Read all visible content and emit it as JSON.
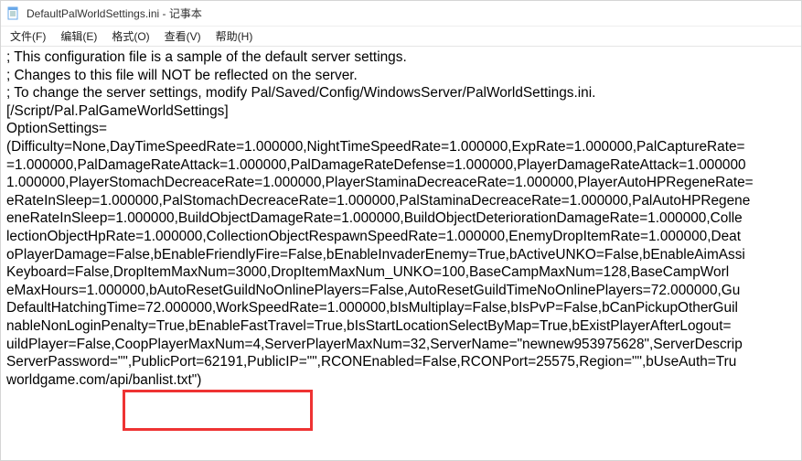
{
  "titlebar": {
    "icon_name": "notepad-icon",
    "title": "DefaultPalWorldSettings.ini - 记事本"
  },
  "menubar": {
    "file": "文件(F)",
    "edit": "编辑(E)",
    "format": "格式(O)",
    "view": "查看(V)",
    "help": "帮助(H)"
  },
  "editor": {
    "text": "; This configuration file is a sample of the default server settings.\n; Changes to this file will NOT be reflected on the server.\n; To change the server settings, modify Pal/Saved/Config/WindowsServer/PalWorldSettings.ini.\n[/Script/Pal.PalGameWorldSettings]\nOptionSettings=\n(Difficulty=None,DayTimeSpeedRate=1.000000,NightTimeSpeedRate=1.000000,ExpRate=1.000000,PalCaptureRate=\n=1.000000,PalDamageRateAttack=1.000000,PalDamageRateDefense=1.000000,PlayerDamageRateAttack=1.000000\n1.000000,PlayerStomachDecreaceRate=1.000000,PlayerStaminaDecreaceRate=1.000000,PlayerAutoHPRegeneRate=\neRateInSleep=1.000000,PalStomachDecreaceRate=1.000000,PalStaminaDecreaceRate=1.000000,PalAutoHPRegene\neneRateInSleep=1.000000,BuildObjectDamageRate=1.000000,BuildObjectDeteriorationDamageRate=1.000000,Colle\nlectionObjectHpRate=1.000000,CollectionObjectRespawnSpeedRate=1.000000,EnemyDropItemRate=1.000000,Deat\noPlayerDamage=False,bEnableFriendlyFire=False,bEnableInvaderEnemy=True,bActiveUNKO=False,bEnableAimAssi\nKeyboard=False,DropItemMaxNum=3000,DropItemMaxNum_UNKO=100,BaseCampMaxNum=128,BaseCampWorl\neMaxHours=1.000000,bAutoResetGuildNoOnlinePlayers=False,AutoResetGuildTimeNoOnlinePlayers=72.000000,Gu\nDefaultHatchingTime=72.000000,WorkSpeedRate=1.000000,bIsMultiplay=False,bIsPvP=False,bCanPickupOtherGuil\nnableNonLoginPenalty=True,bEnableFastTravel=True,bIsStartLocationSelectByMap=True,bExistPlayerAfterLogout=\nuildPlayer=False,CoopPlayerMaxNum=4,ServerPlayerMaxNum=32,ServerName=\"newnew953975628\",ServerDescrip\nServerPassword=\"\",PublicPort=62191,PublicIP=\"\",RCONEnabled=False,RCONPort=25575,Region=\"\",bUseAuth=Tru\nworldgame.com/api/banlist.txt\")\n"
  },
  "highlight": {
    "purpose": "highlight-coop-and-publicport"
  }
}
